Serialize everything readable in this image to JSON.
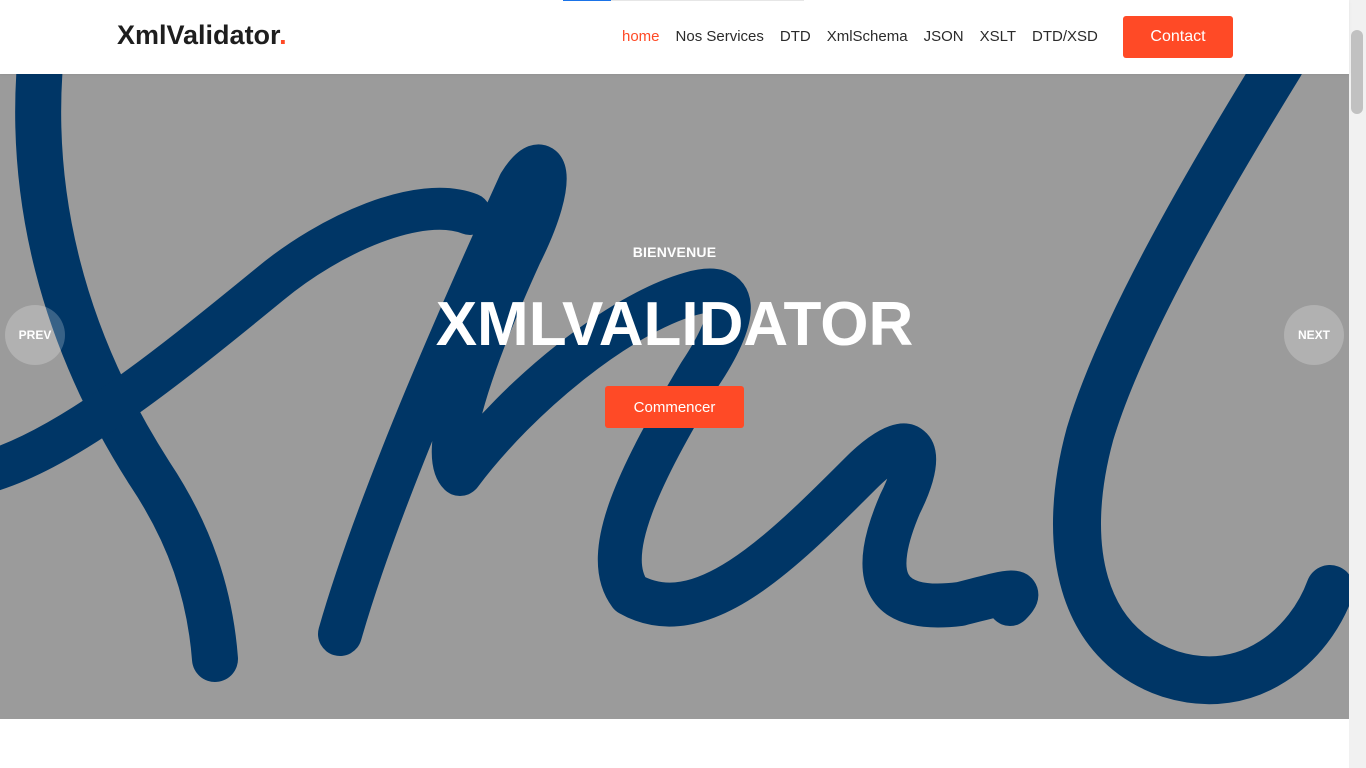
{
  "header": {
    "logo_text": "XmlValidator",
    "logo_dot": ".",
    "nav": [
      {
        "label": "home",
        "active": true
      },
      {
        "label": "Nos Services",
        "active": false
      },
      {
        "label": "DTD",
        "active": false
      },
      {
        "label": "XmlSchema",
        "active": false
      },
      {
        "label": "JSON",
        "active": false
      },
      {
        "label": "XSLT",
        "active": false
      },
      {
        "label": "DTD/XSD",
        "active": false
      }
    ],
    "contact_label": "Contact"
  },
  "hero": {
    "subtitle": "BIENVENUE",
    "title": "XMLVALIDATOR",
    "cta_label": "Commencer",
    "prev_label": "PREV",
    "next_label": "NEXT"
  },
  "colors": {
    "accent": "#ff4a26",
    "hero_overlay": "#9b9b9b",
    "script_blue": "#003666"
  }
}
